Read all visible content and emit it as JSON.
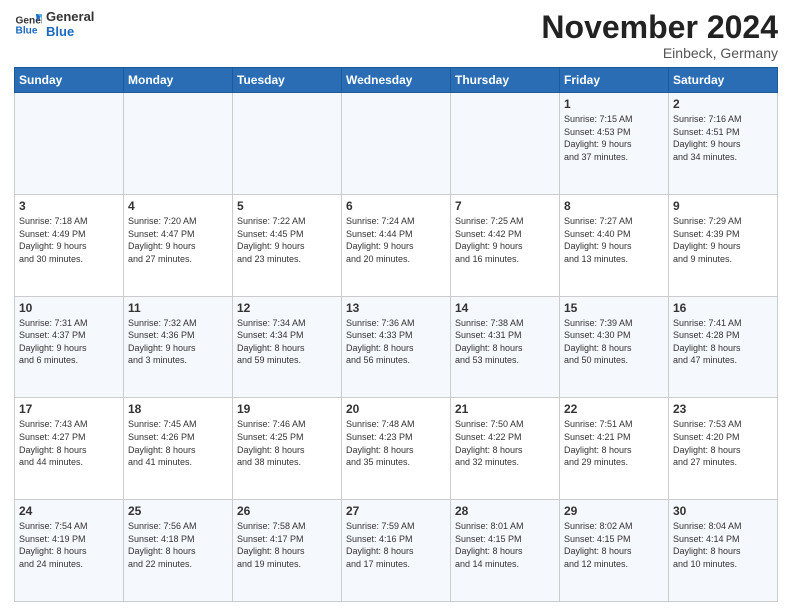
{
  "header": {
    "logo_line1": "General",
    "logo_line2": "Blue",
    "month_title": "November 2024",
    "location": "Einbeck, Germany"
  },
  "weekdays": [
    "Sunday",
    "Monday",
    "Tuesday",
    "Wednesday",
    "Thursday",
    "Friday",
    "Saturday"
  ],
  "weeks": [
    [
      {
        "day": "",
        "info": ""
      },
      {
        "day": "",
        "info": ""
      },
      {
        "day": "",
        "info": ""
      },
      {
        "day": "",
        "info": ""
      },
      {
        "day": "",
        "info": ""
      },
      {
        "day": "1",
        "info": "Sunrise: 7:15 AM\nSunset: 4:53 PM\nDaylight: 9 hours\nand 37 minutes."
      },
      {
        "day": "2",
        "info": "Sunrise: 7:16 AM\nSunset: 4:51 PM\nDaylight: 9 hours\nand 34 minutes."
      }
    ],
    [
      {
        "day": "3",
        "info": "Sunrise: 7:18 AM\nSunset: 4:49 PM\nDaylight: 9 hours\nand 30 minutes."
      },
      {
        "day": "4",
        "info": "Sunrise: 7:20 AM\nSunset: 4:47 PM\nDaylight: 9 hours\nand 27 minutes."
      },
      {
        "day": "5",
        "info": "Sunrise: 7:22 AM\nSunset: 4:45 PM\nDaylight: 9 hours\nand 23 minutes."
      },
      {
        "day": "6",
        "info": "Sunrise: 7:24 AM\nSunset: 4:44 PM\nDaylight: 9 hours\nand 20 minutes."
      },
      {
        "day": "7",
        "info": "Sunrise: 7:25 AM\nSunset: 4:42 PM\nDaylight: 9 hours\nand 16 minutes."
      },
      {
        "day": "8",
        "info": "Sunrise: 7:27 AM\nSunset: 4:40 PM\nDaylight: 9 hours\nand 13 minutes."
      },
      {
        "day": "9",
        "info": "Sunrise: 7:29 AM\nSunset: 4:39 PM\nDaylight: 9 hours\nand 9 minutes."
      }
    ],
    [
      {
        "day": "10",
        "info": "Sunrise: 7:31 AM\nSunset: 4:37 PM\nDaylight: 9 hours\nand 6 minutes."
      },
      {
        "day": "11",
        "info": "Sunrise: 7:32 AM\nSunset: 4:36 PM\nDaylight: 9 hours\nand 3 minutes."
      },
      {
        "day": "12",
        "info": "Sunrise: 7:34 AM\nSunset: 4:34 PM\nDaylight: 8 hours\nand 59 minutes."
      },
      {
        "day": "13",
        "info": "Sunrise: 7:36 AM\nSunset: 4:33 PM\nDaylight: 8 hours\nand 56 minutes."
      },
      {
        "day": "14",
        "info": "Sunrise: 7:38 AM\nSunset: 4:31 PM\nDaylight: 8 hours\nand 53 minutes."
      },
      {
        "day": "15",
        "info": "Sunrise: 7:39 AM\nSunset: 4:30 PM\nDaylight: 8 hours\nand 50 minutes."
      },
      {
        "day": "16",
        "info": "Sunrise: 7:41 AM\nSunset: 4:28 PM\nDaylight: 8 hours\nand 47 minutes."
      }
    ],
    [
      {
        "day": "17",
        "info": "Sunrise: 7:43 AM\nSunset: 4:27 PM\nDaylight: 8 hours\nand 44 minutes."
      },
      {
        "day": "18",
        "info": "Sunrise: 7:45 AM\nSunset: 4:26 PM\nDaylight: 8 hours\nand 41 minutes."
      },
      {
        "day": "19",
        "info": "Sunrise: 7:46 AM\nSunset: 4:25 PM\nDaylight: 8 hours\nand 38 minutes."
      },
      {
        "day": "20",
        "info": "Sunrise: 7:48 AM\nSunset: 4:23 PM\nDaylight: 8 hours\nand 35 minutes."
      },
      {
        "day": "21",
        "info": "Sunrise: 7:50 AM\nSunset: 4:22 PM\nDaylight: 8 hours\nand 32 minutes."
      },
      {
        "day": "22",
        "info": "Sunrise: 7:51 AM\nSunset: 4:21 PM\nDaylight: 8 hours\nand 29 minutes."
      },
      {
        "day": "23",
        "info": "Sunrise: 7:53 AM\nSunset: 4:20 PM\nDaylight: 8 hours\nand 27 minutes."
      }
    ],
    [
      {
        "day": "24",
        "info": "Sunrise: 7:54 AM\nSunset: 4:19 PM\nDaylight: 8 hours\nand 24 minutes."
      },
      {
        "day": "25",
        "info": "Sunrise: 7:56 AM\nSunset: 4:18 PM\nDaylight: 8 hours\nand 22 minutes."
      },
      {
        "day": "26",
        "info": "Sunrise: 7:58 AM\nSunset: 4:17 PM\nDaylight: 8 hours\nand 19 minutes."
      },
      {
        "day": "27",
        "info": "Sunrise: 7:59 AM\nSunset: 4:16 PM\nDaylight: 8 hours\nand 17 minutes."
      },
      {
        "day": "28",
        "info": "Sunrise: 8:01 AM\nSunset: 4:15 PM\nDaylight: 8 hours\nand 14 minutes."
      },
      {
        "day": "29",
        "info": "Sunrise: 8:02 AM\nSunset: 4:15 PM\nDaylight: 8 hours\nand 12 minutes."
      },
      {
        "day": "30",
        "info": "Sunrise: 8:04 AM\nSunset: 4:14 PM\nDaylight: 8 hours\nand 10 minutes."
      }
    ]
  ]
}
